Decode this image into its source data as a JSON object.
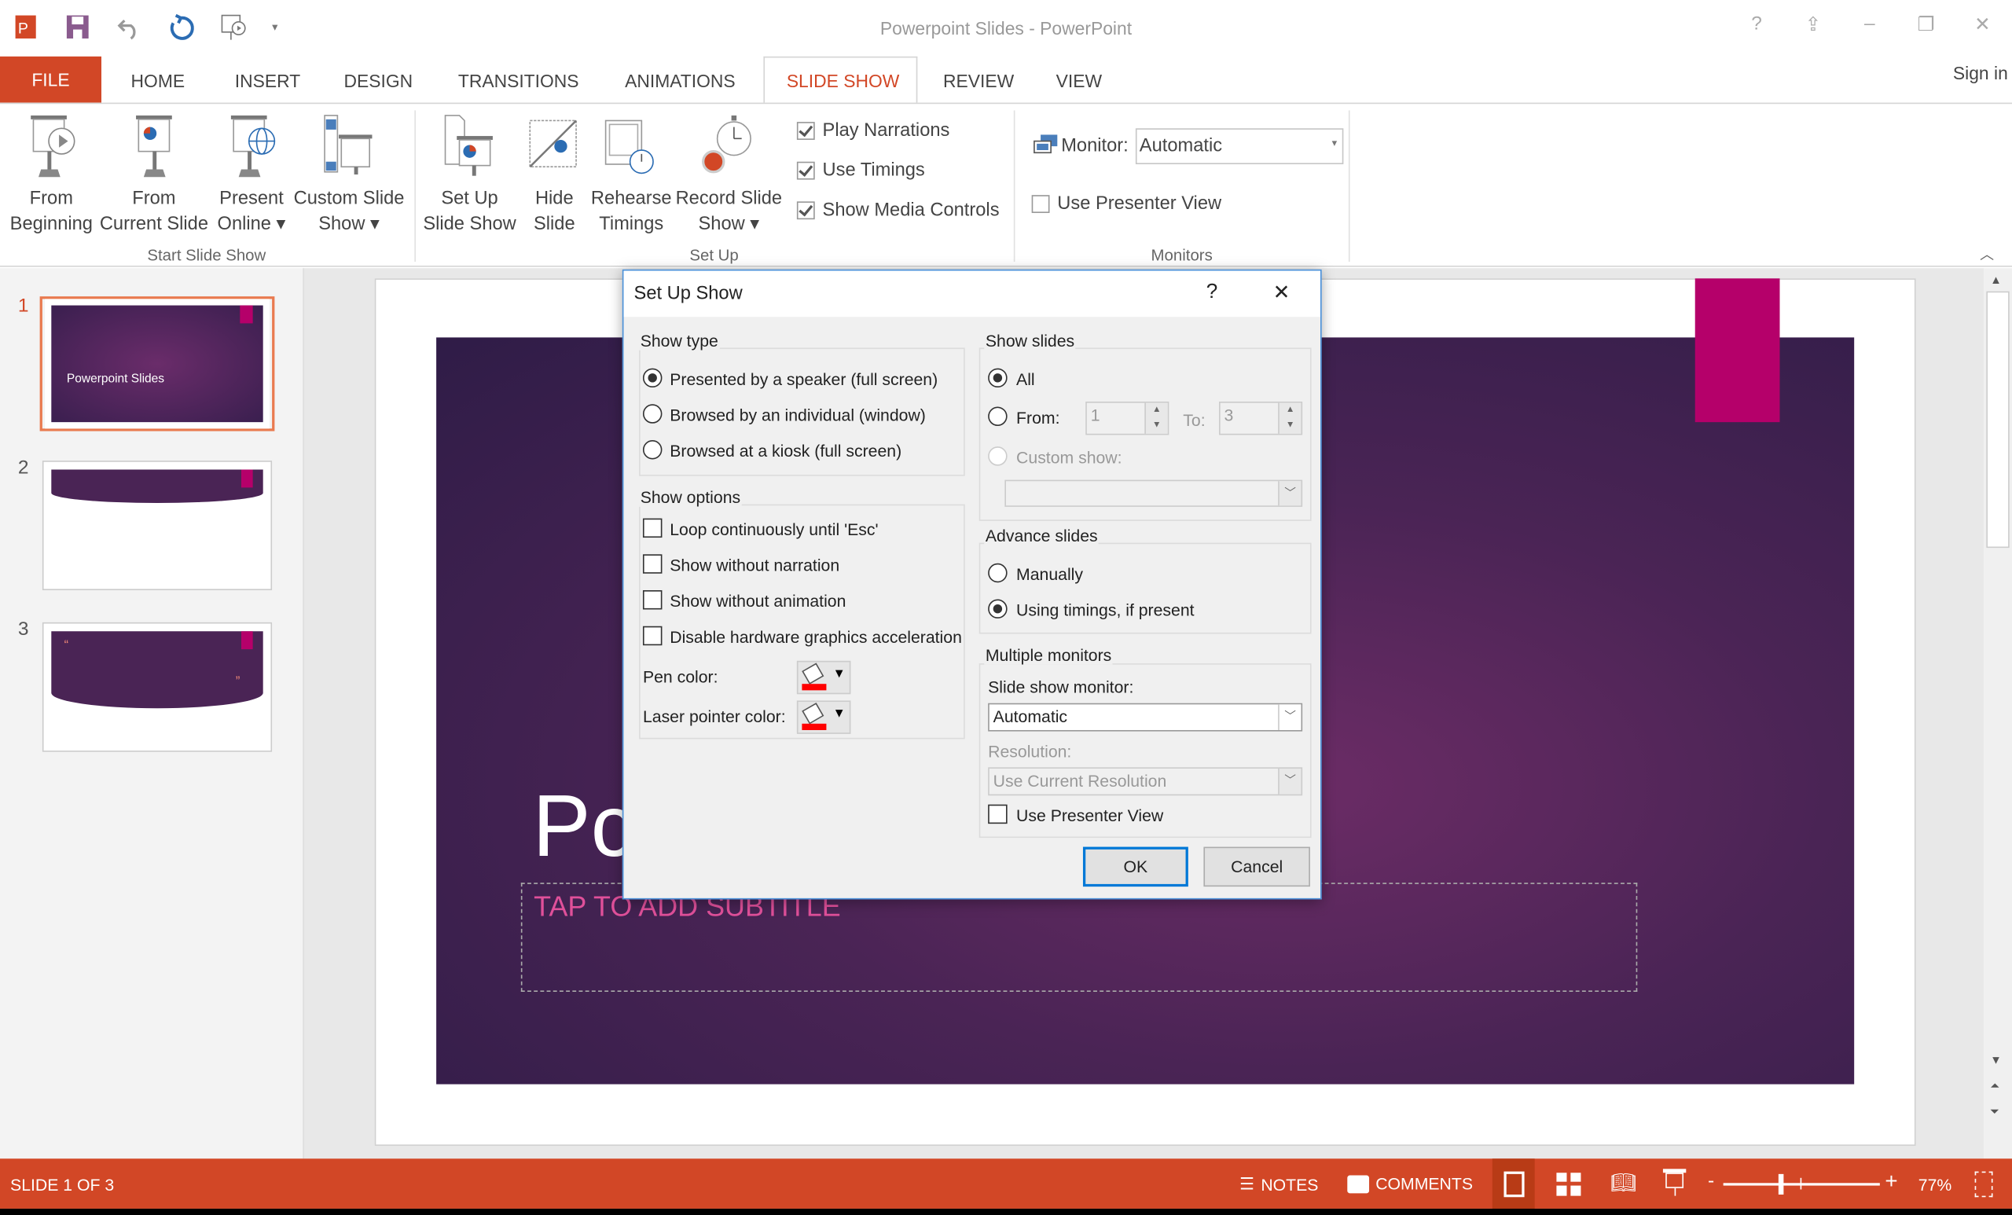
{
  "window": {
    "title": "Powerpoint Slides - PowerPoint",
    "help": "?",
    "sign_in": "Sign in"
  },
  "quick_access": [
    "powerpoint-logo-icon",
    "save-icon",
    "undo-icon",
    "redo-icon",
    "start-from-beginning-icon",
    "customize-quick-access-icon"
  ],
  "tabs": [
    {
      "label": "FILE"
    },
    {
      "label": "HOME"
    },
    {
      "label": "INSERT"
    },
    {
      "label": "DESIGN"
    },
    {
      "label": "TRANSITIONS"
    },
    {
      "label": "ANIMATIONS"
    },
    {
      "label": "SLIDE SHOW",
      "active": true
    },
    {
      "label": "REVIEW"
    },
    {
      "label": "VIEW"
    }
  ],
  "ribbon": {
    "start_group": {
      "label": "Start Slide Show",
      "buttons": [
        {
          "l1": "From",
          "l2": "Beginning"
        },
        {
          "l1": "From",
          "l2": "Current Slide"
        },
        {
          "l1": "Present",
          "l2": "Online ▾"
        },
        {
          "l1": "Custom Slide",
          "l2": "Show ▾"
        }
      ]
    },
    "setup_group": {
      "label": "Set Up",
      "buttons": [
        {
          "l1": "Set Up",
          "l2": "Slide Show"
        },
        {
          "l1": "Hide",
          "l2": "Slide"
        },
        {
          "l1": "Rehearse",
          "l2": "Timings"
        },
        {
          "l1": "Record Slide",
          "l2": "Show ▾"
        }
      ],
      "checks": [
        {
          "label": "Play Narrations",
          "checked": true
        },
        {
          "label": "Use Timings",
          "checked": true
        },
        {
          "label": "Show Media Controls",
          "checked": true
        }
      ]
    },
    "monitors_group": {
      "label": "Monitors",
      "monitor_label": "Monitor:",
      "monitor_value": "Automatic",
      "presenter_view": "Use Presenter View",
      "presenter_checked": false
    }
  },
  "slides": [
    {
      "num": "1",
      "title": "Powerpoint Slides",
      "selected": true
    },
    {
      "num": "2"
    },
    {
      "num": "3",
      "quote_open": "“",
      "quote_close": "”"
    }
  ],
  "slide": {
    "title_partial": "Pc",
    "subtitle_placeholder": "TAP TO ADD SUBTITLE"
  },
  "colors": {
    "accent": "#d24726",
    "slide_bg": "#4a2455",
    "pink": "#b5006a",
    "pen": "#ff0000"
  },
  "dialog": {
    "title": "Set Up Show",
    "help": "?",
    "close": "✕",
    "show_type": {
      "label": "Show type",
      "options": [
        {
          "label": "Presented by a speaker (full screen)",
          "selected": true
        },
        {
          "label": "Browsed by an individual (window)"
        },
        {
          "label": "Browsed at a kiosk (full screen)"
        }
      ]
    },
    "show_options": {
      "label": "Show options",
      "checks": [
        {
          "label": "Loop continuously until 'Esc'",
          "checked": false
        },
        {
          "label": "Show without narration",
          "checked": false
        },
        {
          "label": "Show without animation",
          "checked": false
        },
        {
          "label": "Disable hardware graphics acceleration",
          "checked": false
        }
      ],
      "pen_color": "Pen color:",
      "laser_color": "Laser pointer color:"
    },
    "show_slides": {
      "label": "Show slides",
      "all": "All",
      "from": "From:",
      "from_value": "1",
      "to": "To:",
      "to_value": "3",
      "custom": "Custom show:"
    },
    "advance": {
      "label": "Advance slides",
      "manually": "Manually",
      "timings": "Using timings, if present",
      "selected": "timings"
    },
    "monitors": {
      "label": "Multiple monitors",
      "monitor_label": "Slide show monitor:",
      "monitor_value": "Automatic",
      "resolution_label": "Resolution:",
      "resolution_value": "Use Current Resolution",
      "presenter_view": "Use Presenter View",
      "presenter_checked": false
    },
    "ok": "OK",
    "cancel": "Cancel"
  },
  "status": {
    "slide": "SLIDE 1 OF 3",
    "notes": "NOTES",
    "comments": "COMMENTS",
    "zoom": "77%",
    "zoom_percent": 77
  }
}
